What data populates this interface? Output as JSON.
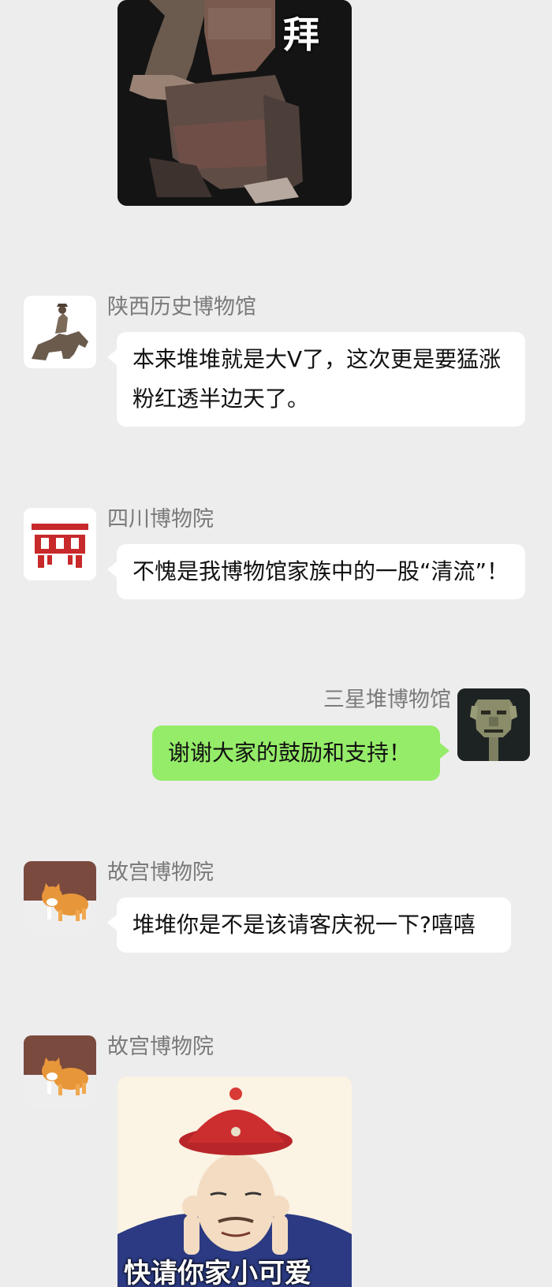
{
  "stickers": {
    "bow": {
      "caption": "拜",
      "description": "terracotta-warrior-kneeling-sticker"
    },
    "cute": {
      "caption": "快请你家小可爱",
      "description": "qing-official-cartoon-sticker"
    }
  },
  "messages": [
    {
      "sender": "陕西历史博物馆",
      "text": "本来堆堆就是大V了，这次更是要猛涨粉红透半边天了。"
    },
    {
      "sender": "四川博物院",
      "text": "不愧是我博物馆家族中的一股“清流”！"
    },
    {
      "sender": "三星堆博物馆",
      "text": "谢谢大家的鼓励和支持！"
    },
    {
      "sender": "故宫博物院",
      "text": "堆堆你是不是该请客庆祝一下?嘻嘻"
    },
    {
      "sender": "故宫博物院",
      "text": ""
    }
  ],
  "colors": {
    "background": "#ededed",
    "incoming_bubble": "#ffffff",
    "outgoing_bubble": "#95ec69",
    "sender_name": "#7a7a7a",
    "sichuan_logo": "#c8292a"
  }
}
